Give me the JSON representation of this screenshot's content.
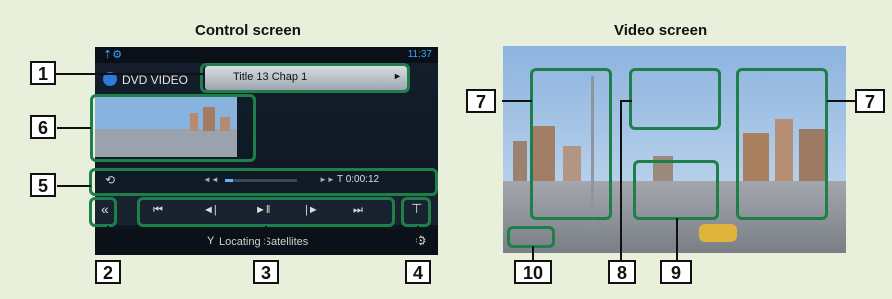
{
  "headings": {
    "control": "Control screen",
    "video": "Video screen"
  },
  "control_screen": {
    "source_label": "DVD VIDEO",
    "title_chapter": "Title 13 Chap  1",
    "play_indicator": "►",
    "time": "T 0:00:12",
    "status_text": "Locating Satellites",
    "clock": "11:37"
  },
  "callouts": [
    "1",
    "2",
    "3",
    "4",
    "5",
    "6",
    "7",
    "7",
    "8",
    "9",
    "10"
  ]
}
